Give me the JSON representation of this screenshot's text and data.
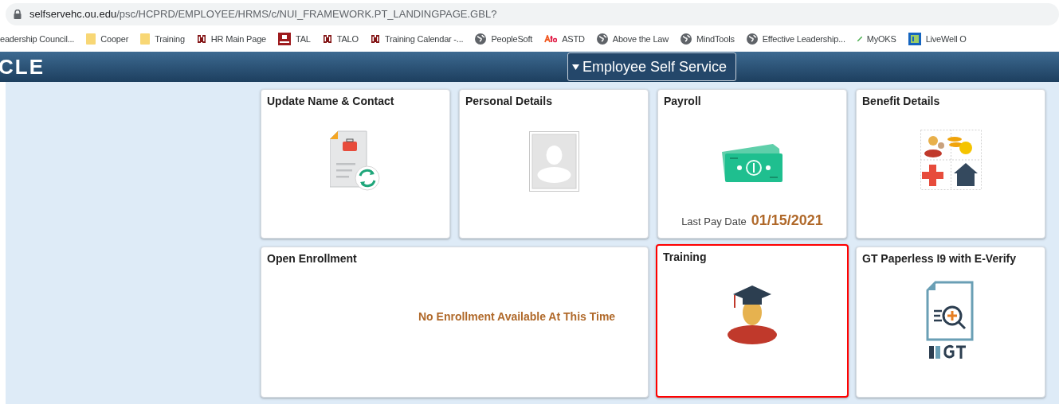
{
  "address_bar": {
    "host": "selfservehc.ou.edu",
    "path": "/psc/HCPRD/EMPLOYEE/HRMS/c/NUI_FRAMEWORK.PT_LANDINGPAGE.GBL?"
  },
  "bookmarks": [
    {
      "kind": "none",
      "label": "eadership Council..."
    },
    {
      "kind": "folder",
      "label": "Cooper"
    },
    {
      "kind": "folder",
      "label": "Training"
    },
    {
      "kind": "ou",
      "label": "HR Main Page"
    },
    {
      "kind": "hsc",
      "label": "TAL"
    },
    {
      "kind": "ou",
      "label": "TALO"
    },
    {
      "kind": "ou",
      "label": "Training Calendar -..."
    },
    {
      "kind": "globe",
      "label": "PeopleSoft"
    },
    {
      "kind": "atd",
      "label": "ASTD"
    },
    {
      "kind": "globe",
      "label": "Above the Law"
    },
    {
      "kind": "globe",
      "label": "MindTools"
    },
    {
      "kind": "globe",
      "label": "Effective Leadership..."
    },
    {
      "kind": "myoks",
      "label": "MyOKS"
    },
    {
      "kind": "livewell",
      "label": "LiveWell O"
    }
  ],
  "header": {
    "logo": "CLE",
    "homepage_menu": "Employee Self Service"
  },
  "tiles": [
    {
      "kind": "contact",
      "title": "Update Name & Contact",
      "selected": false
    },
    {
      "kind": "personal",
      "title": "Personal Details",
      "selected": false
    },
    {
      "kind": "payroll",
      "title": "Payroll",
      "selected": false,
      "caption": "Last Pay Date",
      "value": "01/15/2021"
    },
    {
      "kind": "benefits",
      "title": "Benefit Details",
      "selected": false
    },
    {
      "kind": "enrollment",
      "title": "Open Enrollment",
      "selected": false,
      "message": "No Enrollment Available At This Time"
    },
    {
      "kind": "training",
      "title": "Training",
      "selected": true
    },
    {
      "kind": "i9",
      "title": "GT Paperless I9 with E-Verify",
      "selected": false
    }
  ]
}
